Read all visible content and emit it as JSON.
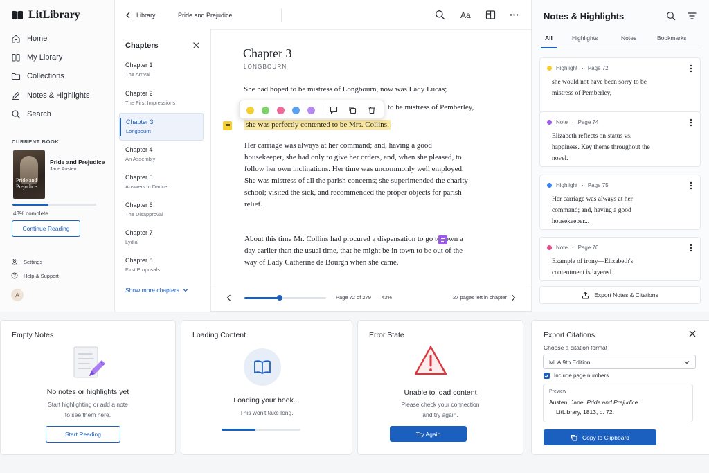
{
  "app": {
    "name": "LitLibrary"
  },
  "sidebar": {
    "items": [
      {
        "label": "Home",
        "icon": "home-icon"
      },
      {
        "label": "My Library",
        "icon": "library-icon"
      },
      {
        "label": "Collections",
        "icon": "folder-icon"
      },
      {
        "label": "Notes & Highlights",
        "icon": "pen-icon"
      },
      {
        "label": "Search",
        "icon": "search-icon"
      }
    ],
    "current_book_label": "CURRENT BOOK",
    "book": {
      "cover_text": "Pride and Prejudice",
      "title": "Pride and Prejudice",
      "author": "Jane Austen",
      "progress": 0.43,
      "progress_label": "43% complete"
    },
    "continue_label": "Continue Reading",
    "settings_label": "Settings",
    "help_label": "Help & Support",
    "avatar_initial": "A"
  },
  "topbar": {
    "back_label": "Library",
    "book_title": "Pride and Prejudice",
    "font_label": "Aa"
  },
  "chapters": {
    "title": "Chapters",
    "items": [
      {
        "title": "Chapter 1",
        "subtitle": "The Arrival"
      },
      {
        "title": "Chapter 2",
        "subtitle": "The First Impressions"
      },
      {
        "title": "Chapter 3",
        "subtitle": "Longbourn",
        "active": true
      },
      {
        "title": "Chapter 4",
        "subtitle": "An Assembly"
      },
      {
        "title": "Chapter 5",
        "subtitle": "Answers in Dance"
      },
      {
        "title": "Chapter 6",
        "subtitle": "The Disapproval"
      },
      {
        "title": "Chapter 7",
        "subtitle": "Lydia"
      },
      {
        "title": "Chapter 8",
        "subtitle": "First Proposals"
      }
    ],
    "show_more_label": "Show more chapters"
  },
  "reader": {
    "chapter_title": "Chapter 3",
    "chapter_subtitle": "LONGBOURN",
    "line1": "She had hoped to be mistress of Longbourn, now was Lady Lucas;",
    "line2_tail": "to be mistress of Pemberley,",
    "line3_highlight": "she was perfectly contented to be Mrs. Collins.",
    "para2": "Her carriage was always at her command; and, having a good housekeeper, she had only to give her orders, and, when she pleased, to follow her own inclinations. Her time was uncommonly well employed. She was mistress of all the parish concerns; she superintended the charity-school; visited the sick, and recommended the proper objects for parish relief.",
    "para3": "About this time Mr. Collins had procured a dispensation to go to town a day earlier than the usual time, that he might be in town to be out of the way of Lady Catherine de Bourgh when she came.",
    "highlight_colors": [
      "#f5cf2e",
      "#7ed16a",
      "#ef6a9a",
      "#5aa1f0",
      "#b58af0"
    ],
    "progress": 0.43,
    "page_label": "Page 72 of 279",
    "percent_label": "43%",
    "pages_left_label": "27 pages left in chapter"
  },
  "notes_panel": {
    "title": "Notes & Highlights",
    "tabs": [
      "All",
      "Highlights",
      "Notes",
      "Bookmarks"
    ],
    "cards": [
      {
        "type": "Highlight",
        "page": "Page 72",
        "color": "#f5cf2e",
        "text": "she would not have been sorry to be mistress of Pemberley,"
      },
      {
        "type": "Note",
        "page": "Page 74",
        "color": "#9b5de5",
        "text": "Elizabeth reflects on status vs. happiness. Key theme throughout the novel."
      },
      {
        "type": "Highlight",
        "page": "Page 75",
        "color": "#3b82f6",
        "text": "Her carriage was always at her command; and, having a good housekeeper..."
      },
      {
        "type": "Note",
        "page": "Page 76",
        "color": "#e24b8a",
        "text": "Example of irony—Elizabeth's contentment is layered."
      }
    ],
    "export_label": "Export Notes & Citations"
  },
  "empty_state": {
    "title": "Empty Notes",
    "heading": "No notes or highlights yet",
    "line1": "Start highlighting or add a note",
    "line2": "to see them here.",
    "button": "Start Reading"
  },
  "loading_state": {
    "title": "Loading Content",
    "heading": "Loading your book...",
    "sub": "This won't take long.",
    "progress": 0.43
  },
  "error_state": {
    "title": "Error State",
    "heading": "Unable to load content",
    "line1": "Please check your connection",
    "line2": "and try again.",
    "button": "Try Again"
  },
  "citation": {
    "title": "Export Citations",
    "format_label": "Choose a citation format",
    "format_value": "MLA 9th Edition",
    "include_pages_label": "Include page numbers",
    "include_pages": true,
    "preview_label": "Preview",
    "preview_line1_a": "Austen, Jane. ",
    "preview_line1_b": "Pride and Prejudice",
    "preview_line1_c": ".",
    "preview_line2": "LitLibrary, 1813, p. 72.",
    "copy_label": "Copy to Clipboard"
  },
  "colors": {
    "accent": "#1b5fbf",
    "highlight": "#fbe9a2",
    "error": "#d9363e"
  }
}
